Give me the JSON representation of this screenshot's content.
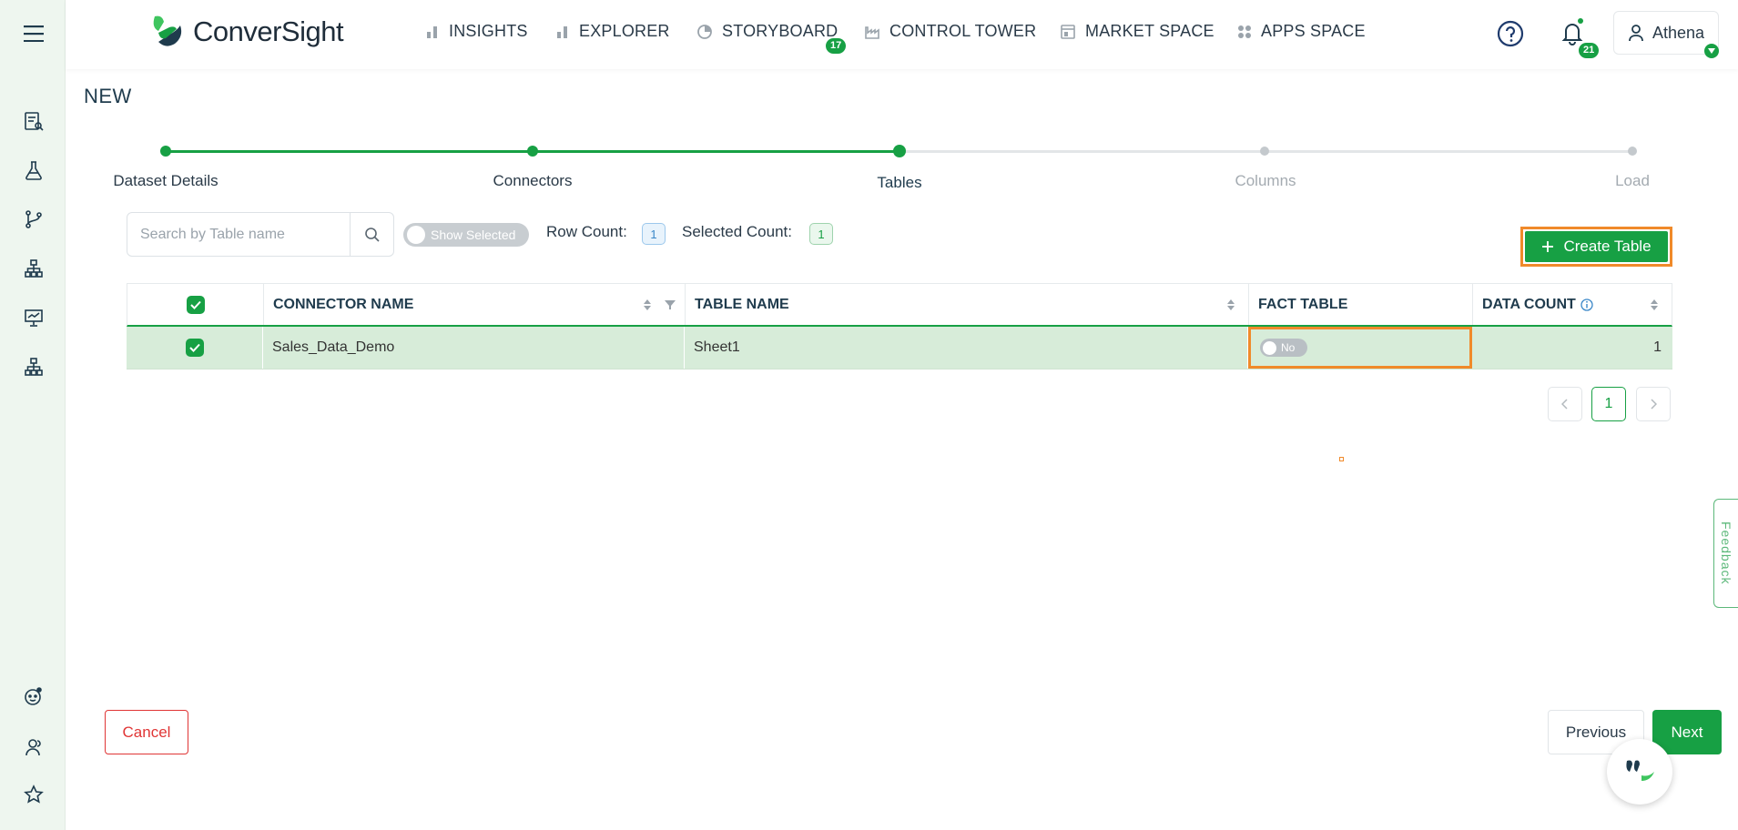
{
  "app": {
    "brand": "ConverSight"
  },
  "nav": {
    "items": [
      {
        "label": "INSIGHTS",
        "icon": "bar-chart-icon"
      },
      {
        "label": "EXPLORER",
        "icon": "bar-chart-icon"
      },
      {
        "label": "STORYBOARD",
        "icon": "pie-icon",
        "badge": "17"
      },
      {
        "label": "CONTROL TOWER",
        "icon": "factory-icon"
      },
      {
        "label": "MARKET SPACE",
        "icon": "store-icon"
      },
      {
        "label": "APPS SPACE",
        "icon": "apps-grid-icon"
      }
    ],
    "notifications_badge": "21",
    "user_name": "Athena"
  },
  "page": {
    "title": "NEW"
  },
  "stepper": {
    "steps": [
      "Dataset Details",
      "Connectors",
      "Tables",
      "Columns",
      "Load"
    ],
    "active_index": 2
  },
  "toolbar": {
    "search_placeholder": "Search by Table name",
    "show_selected_label": "Show Selected",
    "row_count_label": "Row Count:",
    "row_count": "1",
    "selected_count_label": "Selected Count:",
    "selected_count": "1",
    "create_table_label": "Create Table"
  },
  "table": {
    "columns": [
      "CONNECTOR NAME",
      "TABLE NAME",
      "FACT TABLE",
      "DATA COUNT"
    ],
    "rows": [
      {
        "selected": true,
        "connector_name": "Sales_Data_Demo",
        "table_name": "Sheet1",
        "fact_table": "No",
        "data_count": "1"
      }
    ]
  },
  "pagination": {
    "current_page": "1"
  },
  "footer": {
    "cancel_label": "Cancel",
    "previous_label": "Previous",
    "next_label": "Next"
  },
  "feedback_label": "Feedback",
  "colors": {
    "brand_green": "#17a044",
    "highlight_orange": "#f08a2a",
    "row_selected": "#d7ecd9",
    "cancel_red": "#e03535"
  }
}
